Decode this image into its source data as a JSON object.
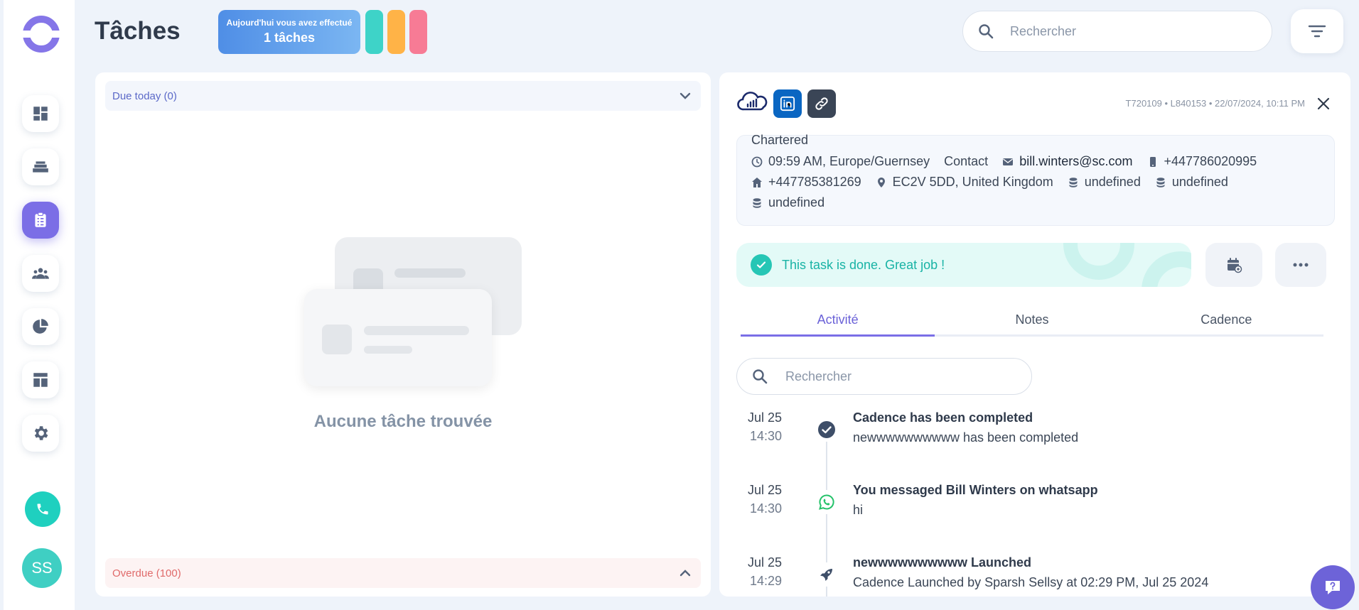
{
  "page": {
    "title": "Tâches"
  },
  "today_badge": {
    "line1": "Aujourd'hui vous avez effectué",
    "line2": "1 tâches"
  },
  "mini_bars": {
    "colors": [
      "#3ed3c8",
      "#ffb347",
      "#f77b95"
    ]
  },
  "search": {
    "placeholder": "Rechercher"
  },
  "sidebar": {
    "items": [
      {
        "icon": "dashboard-icon"
      },
      {
        "icon": "layers-icon"
      },
      {
        "icon": "tasks-icon",
        "active": true
      },
      {
        "icon": "people-icon"
      },
      {
        "icon": "pie-chart-icon"
      },
      {
        "icon": "template-icon"
      },
      {
        "icon": "gear-icon"
      }
    ],
    "avatar_initials": "SS"
  },
  "left_panel": {
    "due_today_label": "Due today (0)",
    "overdue_label": "Overdue (100)",
    "empty_text": "Aucune tâche trouvée"
  },
  "detail": {
    "meta": "T720109 • L840153 • 22/07/2024, 10:11 PM",
    "company": "Chartered",
    "timezone": "09:59 AM, Europe/Guernsey",
    "contact_label": "Contact",
    "email": "bill.winters@sc.com",
    "mobile": "+447786020995",
    "home_phone": "+447785381269",
    "location": "EC2V 5DD, United Kingdom",
    "extra1": "undefined",
    "extra2": "undefined",
    "extra3": "undefined",
    "done_message": "This task is done. Great job !",
    "tabs": [
      "Activité",
      "Notes",
      "Cadence"
    ],
    "activity_search_placeholder": "Rechercher",
    "activities": [
      {
        "date": "Jul 25",
        "time": "14:30",
        "icon": "check-icon",
        "title": "Cadence has been completed",
        "desc": "newwwwwwwwww has been completed"
      },
      {
        "date": "Jul 25",
        "time": "14:30",
        "icon": "whatsapp-icon",
        "title": "You messaged Bill Winters on whatsapp",
        "desc": "hi"
      },
      {
        "date": "Jul 25",
        "time": "14:29",
        "icon": "rocket-icon",
        "title": "newwwwwwwwww Launched",
        "desc": "Cadence Launched by Sparsh Sellsy at 02:29 PM, Jul 25 2024"
      }
    ]
  },
  "colors": {
    "accent": "#7b6ee6",
    "success": "#26c6b5",
    "overdue": "#e06a6a"
  }
}
